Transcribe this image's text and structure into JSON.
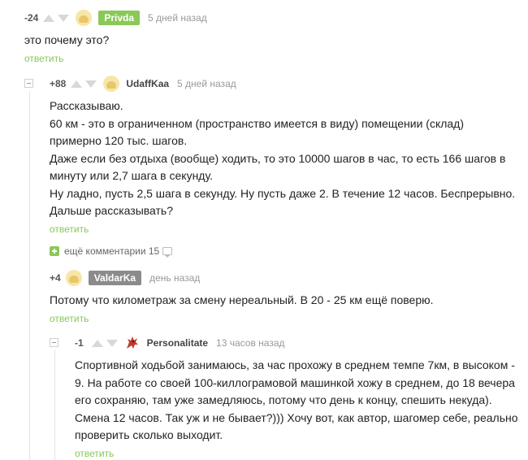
{
  "comments": [
    {
      "rating": "-24",
      "author": "Privda",
      "time": "5 дней назад",
      "text": "это почему это?",
      "reply": "ответить"
    },
    {
      "rating": "+88",
      "author": "UdaffKaa",
      "time": "5 дней назад",
      "lines": [
        "Рассказываю.",
        "60 км - это в ограниченном (пространство имеется в виду) помещении (склад)",
        "примерно 120 тыс. шагов.",
        "Даже если без отдыха (вообще) ходить, то это 10000 шагов в час, то есть 166 шагов в",
        "минуту или 2,7 шага в секунду.",
        "Ну ладно, пусть 2,5 шага в секунду. Ну пусть даже 2. В течение 12 часов. Беспрерывно.",
        "Дальше рассказывать?"
      ],
      "reply": "ответить"
    },
    {
      "rating": "+4",
      "author": "ValdarKa",
      "time": "день назад",
      "text": "Потому что километраж за смену нереальный. В 20 - 25 км ещё поверю.",
      "reply": "ответить"
    },
    {
      "rating": "-1",
      "author": "Personalitate",
      "time": "13 часов назад",
      "lines": [
        "Спортивной ходьбой занимаюсь, за час прохожу в среднем темпе 7км, в высоком -",
        "9. На работе со своей 100-киллограмовой машинкой хожу в среднем, до 18 вечера",
        "его сохраняю, там уже замедляюсь, потому что день к концу, спешить некуда).",
        "Смена 12 часов. Так уж и не бывает?))) Хочу вот, как автор, шагомер себе, реально",
        "проверить сколько выходит."
      ],
      "reply": "ответить"
    }
  ],
  "more_comments": "ещё комментарии 15",
  "colors": {
    "accent_green": "#8ac858",
    "badge_gray": "#8b8b8b"
  }
}
